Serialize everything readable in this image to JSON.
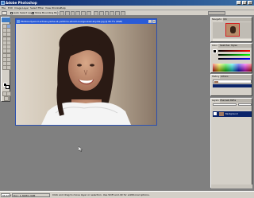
{
  "app": {
    "title": "Adobe Photoshop",
    "window_buttons": {
      "minimize": "_",
      "maximize": "□",
      "close": "×"
    }
  },
  "menu": [
    "File",
    "Edit",
    "Image",
    "Layer",
    "Select",
    "Filter",
    "View",
    "Window",
    "Help"
  ],
  "options_bar": {
    "auto_select_layer": "Auto Select Layer",
    "show_bounding_box": "Show Bounding Box"
  },
  "document": {
    "title": "PSCN-bollywood-actress-yasha-ali-yamtime-edoom-lounge-wear-at-joba.jpg @ 66.7% (RGB)",
    "close": "×",
    "min": "_"
  },
  "navigator": {
    "tabs": [
      "Navigator",
      "Info"
    ]
  },
  "color": {
    "tabs": [
      "Color",
      "Swatches",
      "Styles"
    ]
  },
  "history": {
    "tabs": [
      "History",
      "Actions"
    ]
  },
  "layers": {
    "tabs": [
      "Layers",
      "Channels",
      "Paths"
    ],
    "layer_name": "Background"
  },
  "status_bar": {
    "zoom": "66.67%",
    "doc_size": "Doc: 1.30M/1.30M",
    "hint": "Click and drag to move layer or selection. Use Shift and Alt for additional options."
  },
  "colors": {
    "title_bar": "#0a246a",
    "workspace": "#808080",
    "doc_title": "#2a5bd7"
  }
}
